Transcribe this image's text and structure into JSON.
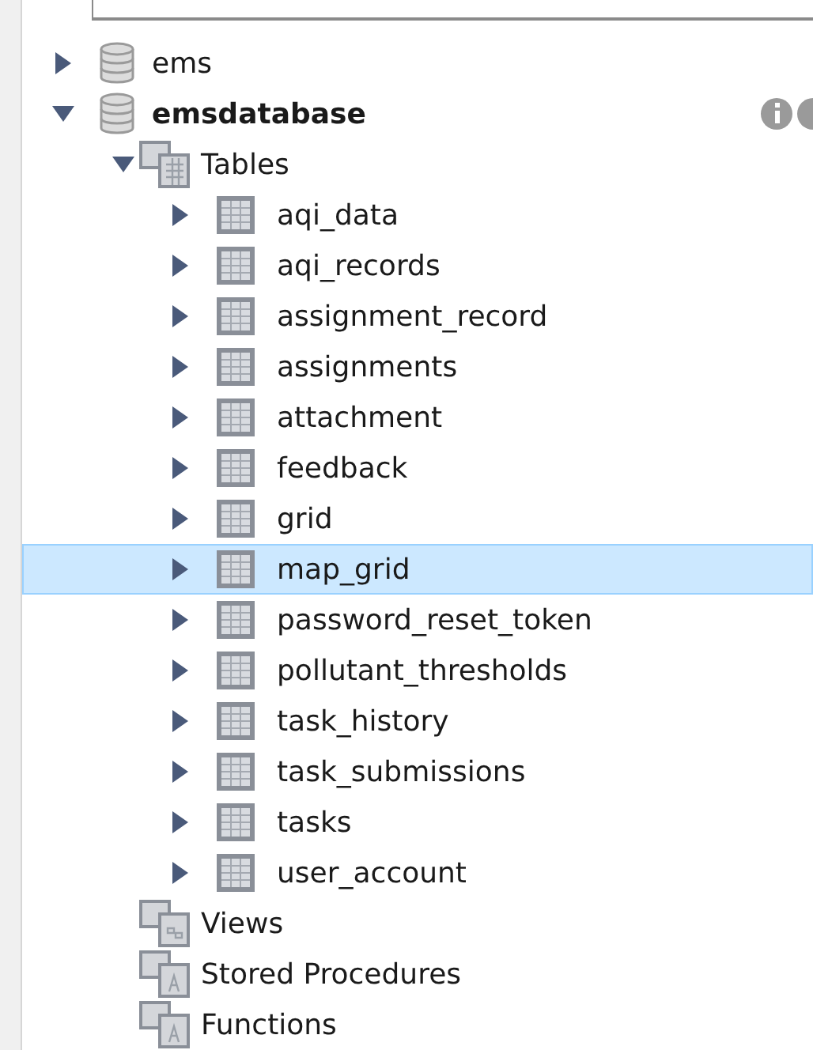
{
  "schemas": [
    {
      "name": "ems",
      "expanded": false,
      "active": false
    },
    {
      "name": "emsdatabase",
      "expanded": true,
      "active": true,
      "groups": [
        {
          "name": "Tables",
          "kind": "tables",
          "expanded": true,
          "items": [
            {
              "name": "aqi_data",
              "selected": false
            },
            {
              "name": "aqi_records",
              "selected": false
            },
            {
              "name": "assignment_record",
              "selected": false
            },
            {
              "name": "assignments",
              "selected": false
            },
            {
              "name": "attachment",
              "selected": false
            },
            {
              "name": "feedback",
              "selected": false
            },
            {
              "name": "grid",
              "selected": false
            },
            {
              "name": "map_grid",
              "selected": true
            },
            {
              "name": "password_reset_token",
              "selected": false
            },
            {
              "name": "pollutant_thresholds",
              "selected": false
            },
            {
              "name": "task_history",
              "selected": false
            },
            {
              "name": "task_submissions",
              "selected": false
            },
            {
              "name": "tasks",
              "selected": false
            },
            {
              "name": "user_account",
              "selected": false
            }
          ]
        },
        {
          "name": "Views",
          "kind": "views"
        },
        {
          "name": "Stored Procedures",
          "kind": "procedures"
        },
        {
          "name": "Functions",
          "kind": "functions"
        }
      ]
    }
  ]
}
